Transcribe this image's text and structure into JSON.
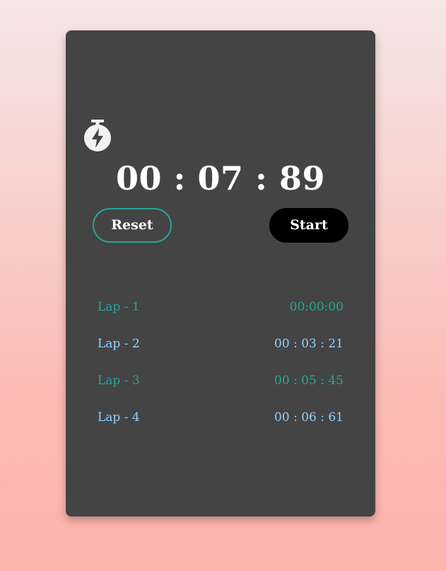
{
  "timer": {
    "display": "00 : 07 : 89",
    "icon": "stopwatch-icon"
  },
  "buttons": {
    "reset_label": "Reset",
    "start_label": "Start"
  },
  "laps": [
    {
      "name": "Lap - 1",
      "time": "00:00:00"
    },
    {
      "name": "Lap - 2",
      "time": "00 : 03 : 21"
    },
    {
      "name": "Lap - 3",
      "time": "00 : 05 : 45"
    },
    {
      "name": "Lap - 4",
      "time": "00 : 06 : 61"
    }
  ],
  "colors": {
    "card": "#444444",
    "accent_teal": "#26a69a",
    "accent_blue": "#8fd1ff",
    "start_button": "#000000",
    "text": "#ffffff"
  }
}
